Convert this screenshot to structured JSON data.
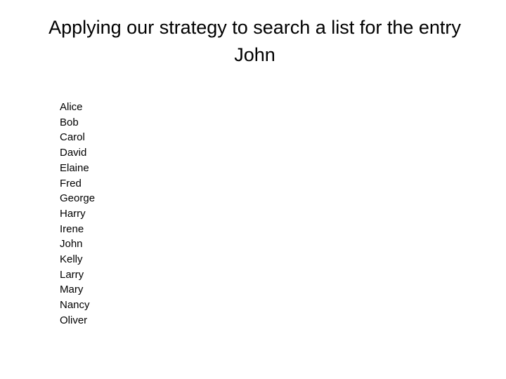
{
  "slide": {
    "title": "Applying our strategy to search a list for the entry John",
    "names": [
      "Alice",
      "Bob",
      "Carol",
      "David",
      "Elaine",
      "Fred",
      "George",
      "Harry",
      "Irene",
      "John",
      "Kelly",
      "Larry",
      "Mary",
      "Nancy",
      "Oliver"
    ]
  }
}
